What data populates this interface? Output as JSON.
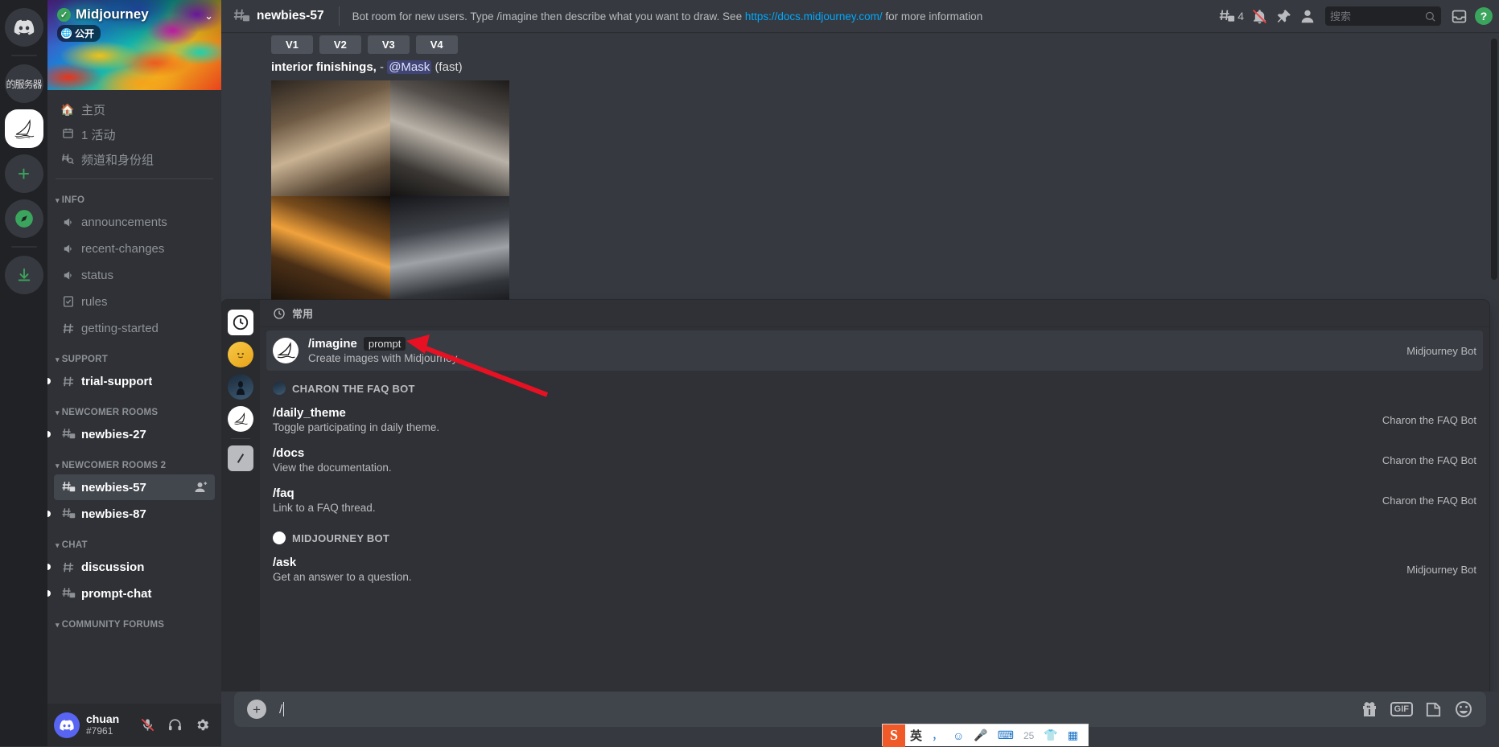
{
  "rail": {
    "items": [
      {
        "name": "discord-home",
        "label": "",
        "icon": "discord-logo"
      },
      {
        "name": "server-cn",
        "label": "的服务器",
        "icon": "text"
      },
      {
        "name": "server-midjourney",
        "label": "",
        "icon": "midjourney-sail",
        "active": true
      },
      {
        "name": "add-server",
        "label": "+",
        "icon": "plus"
      },
      {
        "name": "explore-servers",
        "label": "",
        "icon": "compass"
      },
      {
        "name": "download-apps",
        "label": "",
        "icon": "download"
      }
    ]
  },
  "sidebar": {
    "server_name": "Midjourney",
    "public_badge": "公开",
    "quick_nav": [
      {
        "label": "主页",
        "icon": "home-icon"
      },
      {
        "label": "1 活动",
        "icon": "calendar-icon"
      },
      {
        "label": "频道和身份组",
        "icon": "channels-roles-icon"
      }
    ],
    "categories": [
      {
        "label": "INFO",
        "channels": [
          {
            "label": "announcements",
            "icon": "announcement-icon",
            "state": "read"
          },
          {
            "label": "recent-changes",
            "icon": "announcement-icon",
            "state": "read"
          },
          {
            "label": "status",
            "icon": "announcement-icon",
            "state": "read"
          },
          {
            "label": "rules",
            "icon": "rules-icon",
            "state": "read"
          },
          {
            "label": "getting-started",
            "icon": "hash-icon",
            "state": "read"
          }
        ]
      },
      {
        "label": "SUPPORT",
        "channels": [
          {
            "label": "trial-support",
            "icon": "hash-icon",
            "state": "unread"
          }
        ]
      },
      {
        "label": "NEWCOMER ROOMS",
        "channels": [
          {
            "label": "newbies-27",
            "icon": "hash-thread-icon",
            "state": "unread"
          }
        ]
      },
      {
        "label": "NEWCOMER ROOMS 2",
        "channels": [
          {
            "label": "newbies-57",
            "icon": "hash-thread-icon",
            "state": "selected"
          },
          {
            "label": "newbies-87",
            "icon": "hash-thread-icon",
            "state": "unread"
          }
        ]
      },
      {
        "label": "CHAT",
        "channels": [
          {
            "label": "discussion",
            "icon": "hash-icon",
            "state": "unread"
          },
          {
            "label": "prompt-chat",
            "icon": "hash-thread-icon",
            "state": "unread"
          }
        ]
      },
      {
        "label": "COMMUNITY FORUMS",
        "channels": []
      }
    ],
    "user": {
      "name": "chuan",
      "tag": "#7961",
      "mic": "muted",
      "headset": "on",
      "settings": "gear-icon"
    }
  },
  "topbar": {
    "channel": "newbies-57",
    "topic_before": "Bot room for new users. Type /imagine then describe what you want to draw. See ",
    "topic_link": "https://docs.midjourney.com/",
    "topic_after": " for more information",
    "thread_count": "4",
    "search_placeholder": "搜索",
    "help_label": "?"
  },
  "messages": {
    "variant_buttons": [
      "V1",
      "V2",
      "V3",
      "V4"
    ],
    "caption_text": "interior finishings,",
    "caption_dash": "-",
    "caption_mention": "@Mask",
    "caption_mode": "(fast)"
  },
  "popup": {
    "section_label": "常用",
    "highlighted": {
      "name": "/imagine",
      "arg": "prompt",
      "desc": "Create images with Midjourney",
      "owner": "Midjourney Bot"
    },
    "groups": [
      {
        "bot": "CHARON THE FAQ BOT",
        "commands": [
          {
            "name": "/daily_theme",
            "desc": "Toggle participating in daily theme.",
            "owner": "Charon the FAQ Bot"
          },
          {
            "name": "/docs",
            "desc": "View the documentation.",
            "owner": "Charon the FAQ Bot"
          },
          {
            "name": "/faq",
            "desc": "Link to a FAQ thread.",
            "owner": "Charon the FAQ Bot"
          }
        ]
      },
      {
        "bot": "MIDJOURNEY BOT",
        "commands": [
          {
            "name": "/ask",
            "desc": "Get an answer to a question.",
            "owner": "Midjourney Bot"
          }
        ]
      }
    ]
  },
  "composer": {
    "value": "/",
    "icons": [
      "gift-icon",
      "gif-icon",
      "sticker-icon",
      "emoji-icon"
    ]
  },
  "ime": {
    "logo": "S",
    "items": [
      "英",
      "，",
      "☺",
      "🎤",
      "⌨",
      "25",
      "👕",
      "▦"
    ]
  },
  "colors": {
    "accent": "#5865f2",
    "link": "#00a8fc",
    "green": "#3ba55d",
    "arrow": "#e81123",
    "sidebar_bg": "#2f3136",
    "main_bg": "#36393f",
    "rail_bg": "#202225"
  }
}
